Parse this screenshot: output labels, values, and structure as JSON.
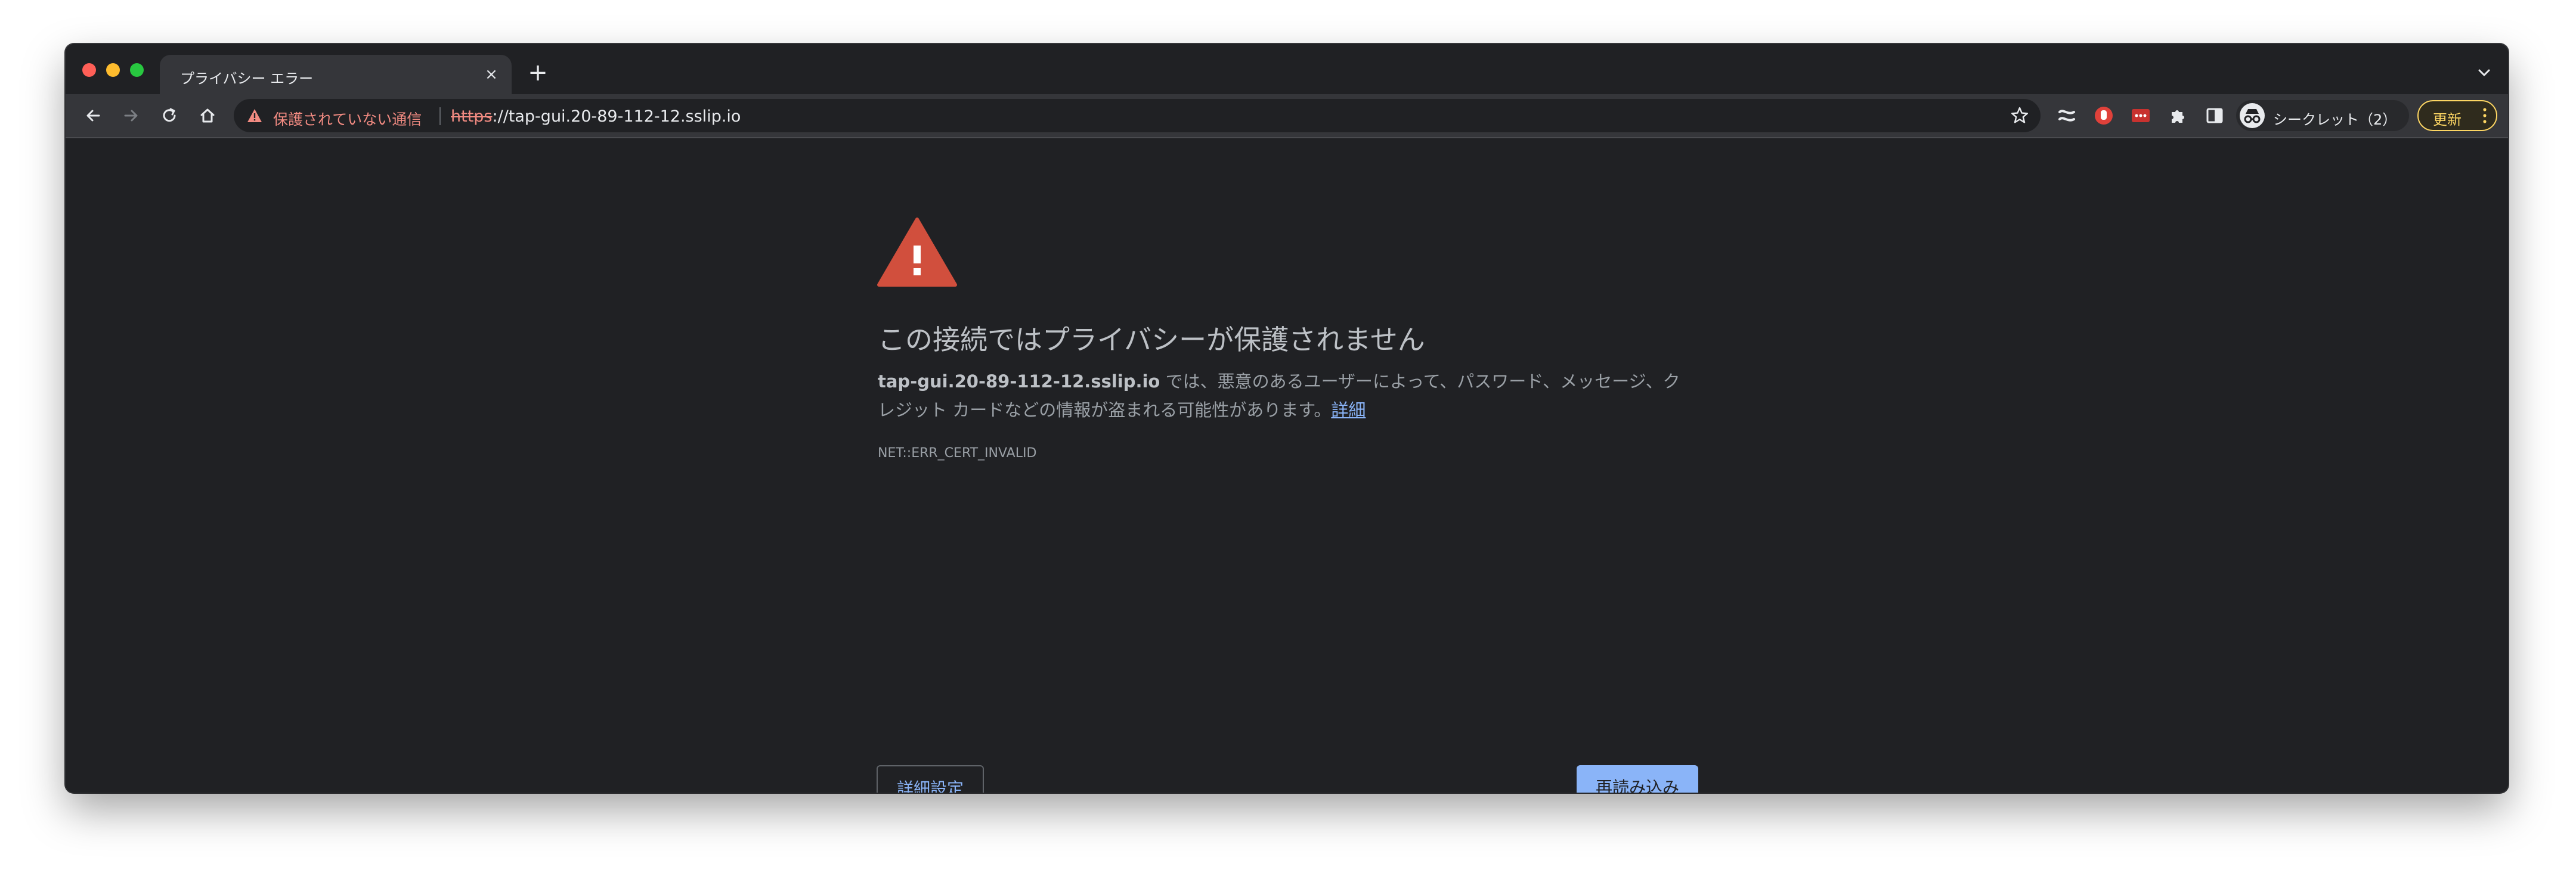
{
  "tab": {
    "title": "プライバシー エラー",
    "close": "×",
    "new_tab": "+"
  },
  "omnibox": {
    "security_label": "保護されていない通信",
    "url_scheme": "https",
    "url_rest": "://tap-gui.20-89-112-12.sslip.io"
  },
  "toolbar": {
    "profile_label": "シークレット（2）",
    "update_label": "更新"
  },
  "page": {
    "heading": "この接続ではプライバシーが保護されません",
    "host": "tap-gui.20-89-112-12.sslip.io",
    "description": " では、悪意のあるユーザーによって、パスワード、メッセージ、クレジット カードなどの情報が盗まれる可能性があります。",
    "details_link": "詳細",
    "error_code": "NET::ERR_CERT_INVALID",
    "advanced_button": "詳細設定",
    "reload_button": "再読み込み"
  },
  "colors": {
    "background": "#202124",
    "toolbar": "#35363a",
    "warning_red": "#f28b82",
    "danger_icon": "#d14f3d",
    "link_blue": "#8ab4f8",
    "update_yellow": "#fdd663"
  }
}
